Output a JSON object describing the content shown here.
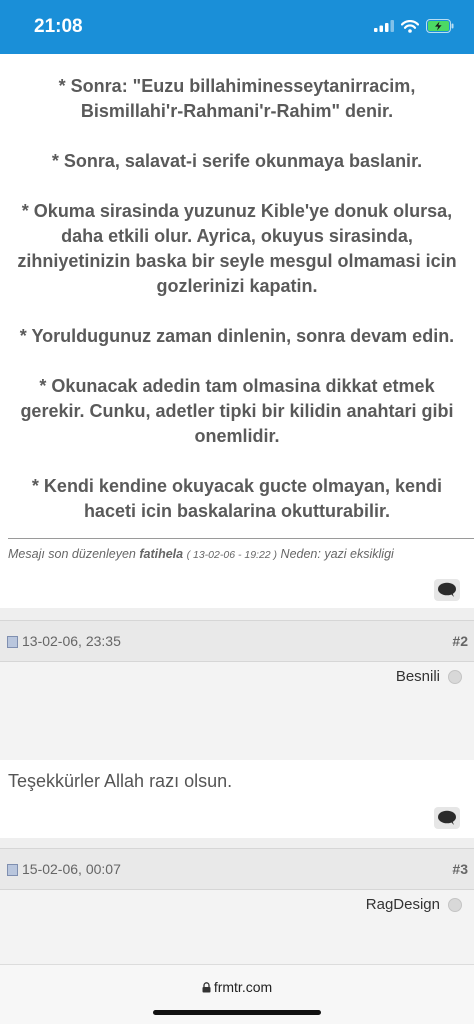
{
  "status_bar": {
    "time": "21:08"
  },
  "post1": {
    "paragraphs": [
      "* Sonra: \"Euzu billahiminesseytanirracim, Bismillahi'r-Rahmani'r-Rahim\" denir.",
      "* Sonra, salavat-i serife okunmaya baslanir.",
      "* Okuma sirasinda yuzunuz Kible'ye donuk olursa, daha etkili olur. Ayrica, okuyus sirasinda, zihniyetinizin baska bir seyle mesgul olmamasi icin gozlerinizi kapatin.",
      "* Yoruldugunuz zaman dinlenin, sonra devam edin.",
      "* Okunacak adedin tam olmasina dikkat etmek gerekir. Cunku, adetler tipki bir kilidin anahtari gibi onemlidir.",
      "* Kendi kendine okuyacak gucte olmayan, kendi haceti icin baskalarina okutturabilir."
    ],
    "edit_note": {
      "prefix": "Mesajı son düzenleyen",
      "user": "fatihela",
      "date": "( 13-02-06 - 19:22 )",
      "reason": "Neden: yazi eksikligi"
    }
  },
  "post2": {
    "date": "13-02-06, 23:35",
    "number": "#2",
    "username": "Besnili",
    "message": "Teşekkürler Allah razı olsun."
  },
  "post3": {
    "date": "15-02-06, 00:07",
    "number": "#3",
    "username": "RagDesign"
  },
  "browser": {
    "url": "frmtr.com"
  },
  "icons": {
    "quote": "speech-bubble-icon",
    "post": "post-icon",
    "lock": "lock-icon",
    "status": "user-status-dot"
  }
}
